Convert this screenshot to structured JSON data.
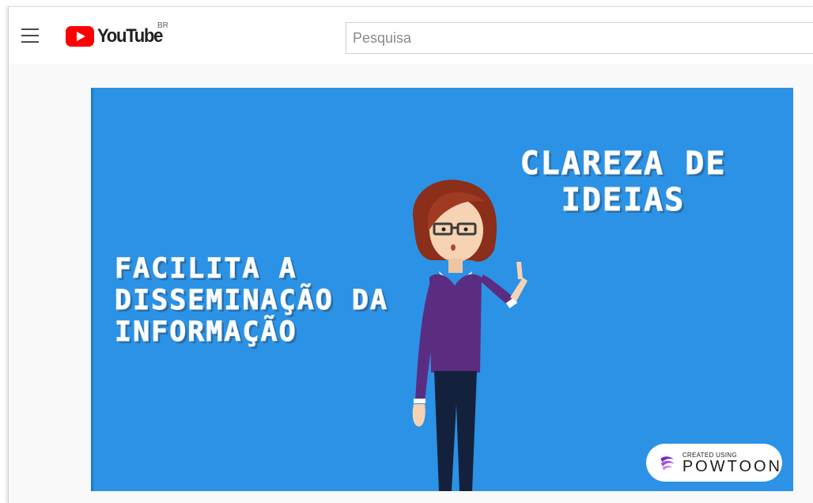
{
  "masthead": {
    "logo_text": "YouTube",
    "country_code": "BR",
    "search_placeholder": "Pesquisa"
  },
  "video": {
    "slide_text_right": "CLAREZA DE IDEIAS",
    "slide_text_left": "FACILITA A DISSEMINAÇÃO DA INFORMAÇÃO",
    "badge_small": "CREATED USING",
    "badge_brand": "POWTOON"
  },
  "colors": {
    "youtube_red": "#ff0000",
    "slide_background": "#2b92e5",
    "powtoon_purple": "#7b2cbf"
  },
  "icons": [
    "menu-icon",
    "youtube-play-icon",
    "powtoon-logo-icon"
  ]
}
